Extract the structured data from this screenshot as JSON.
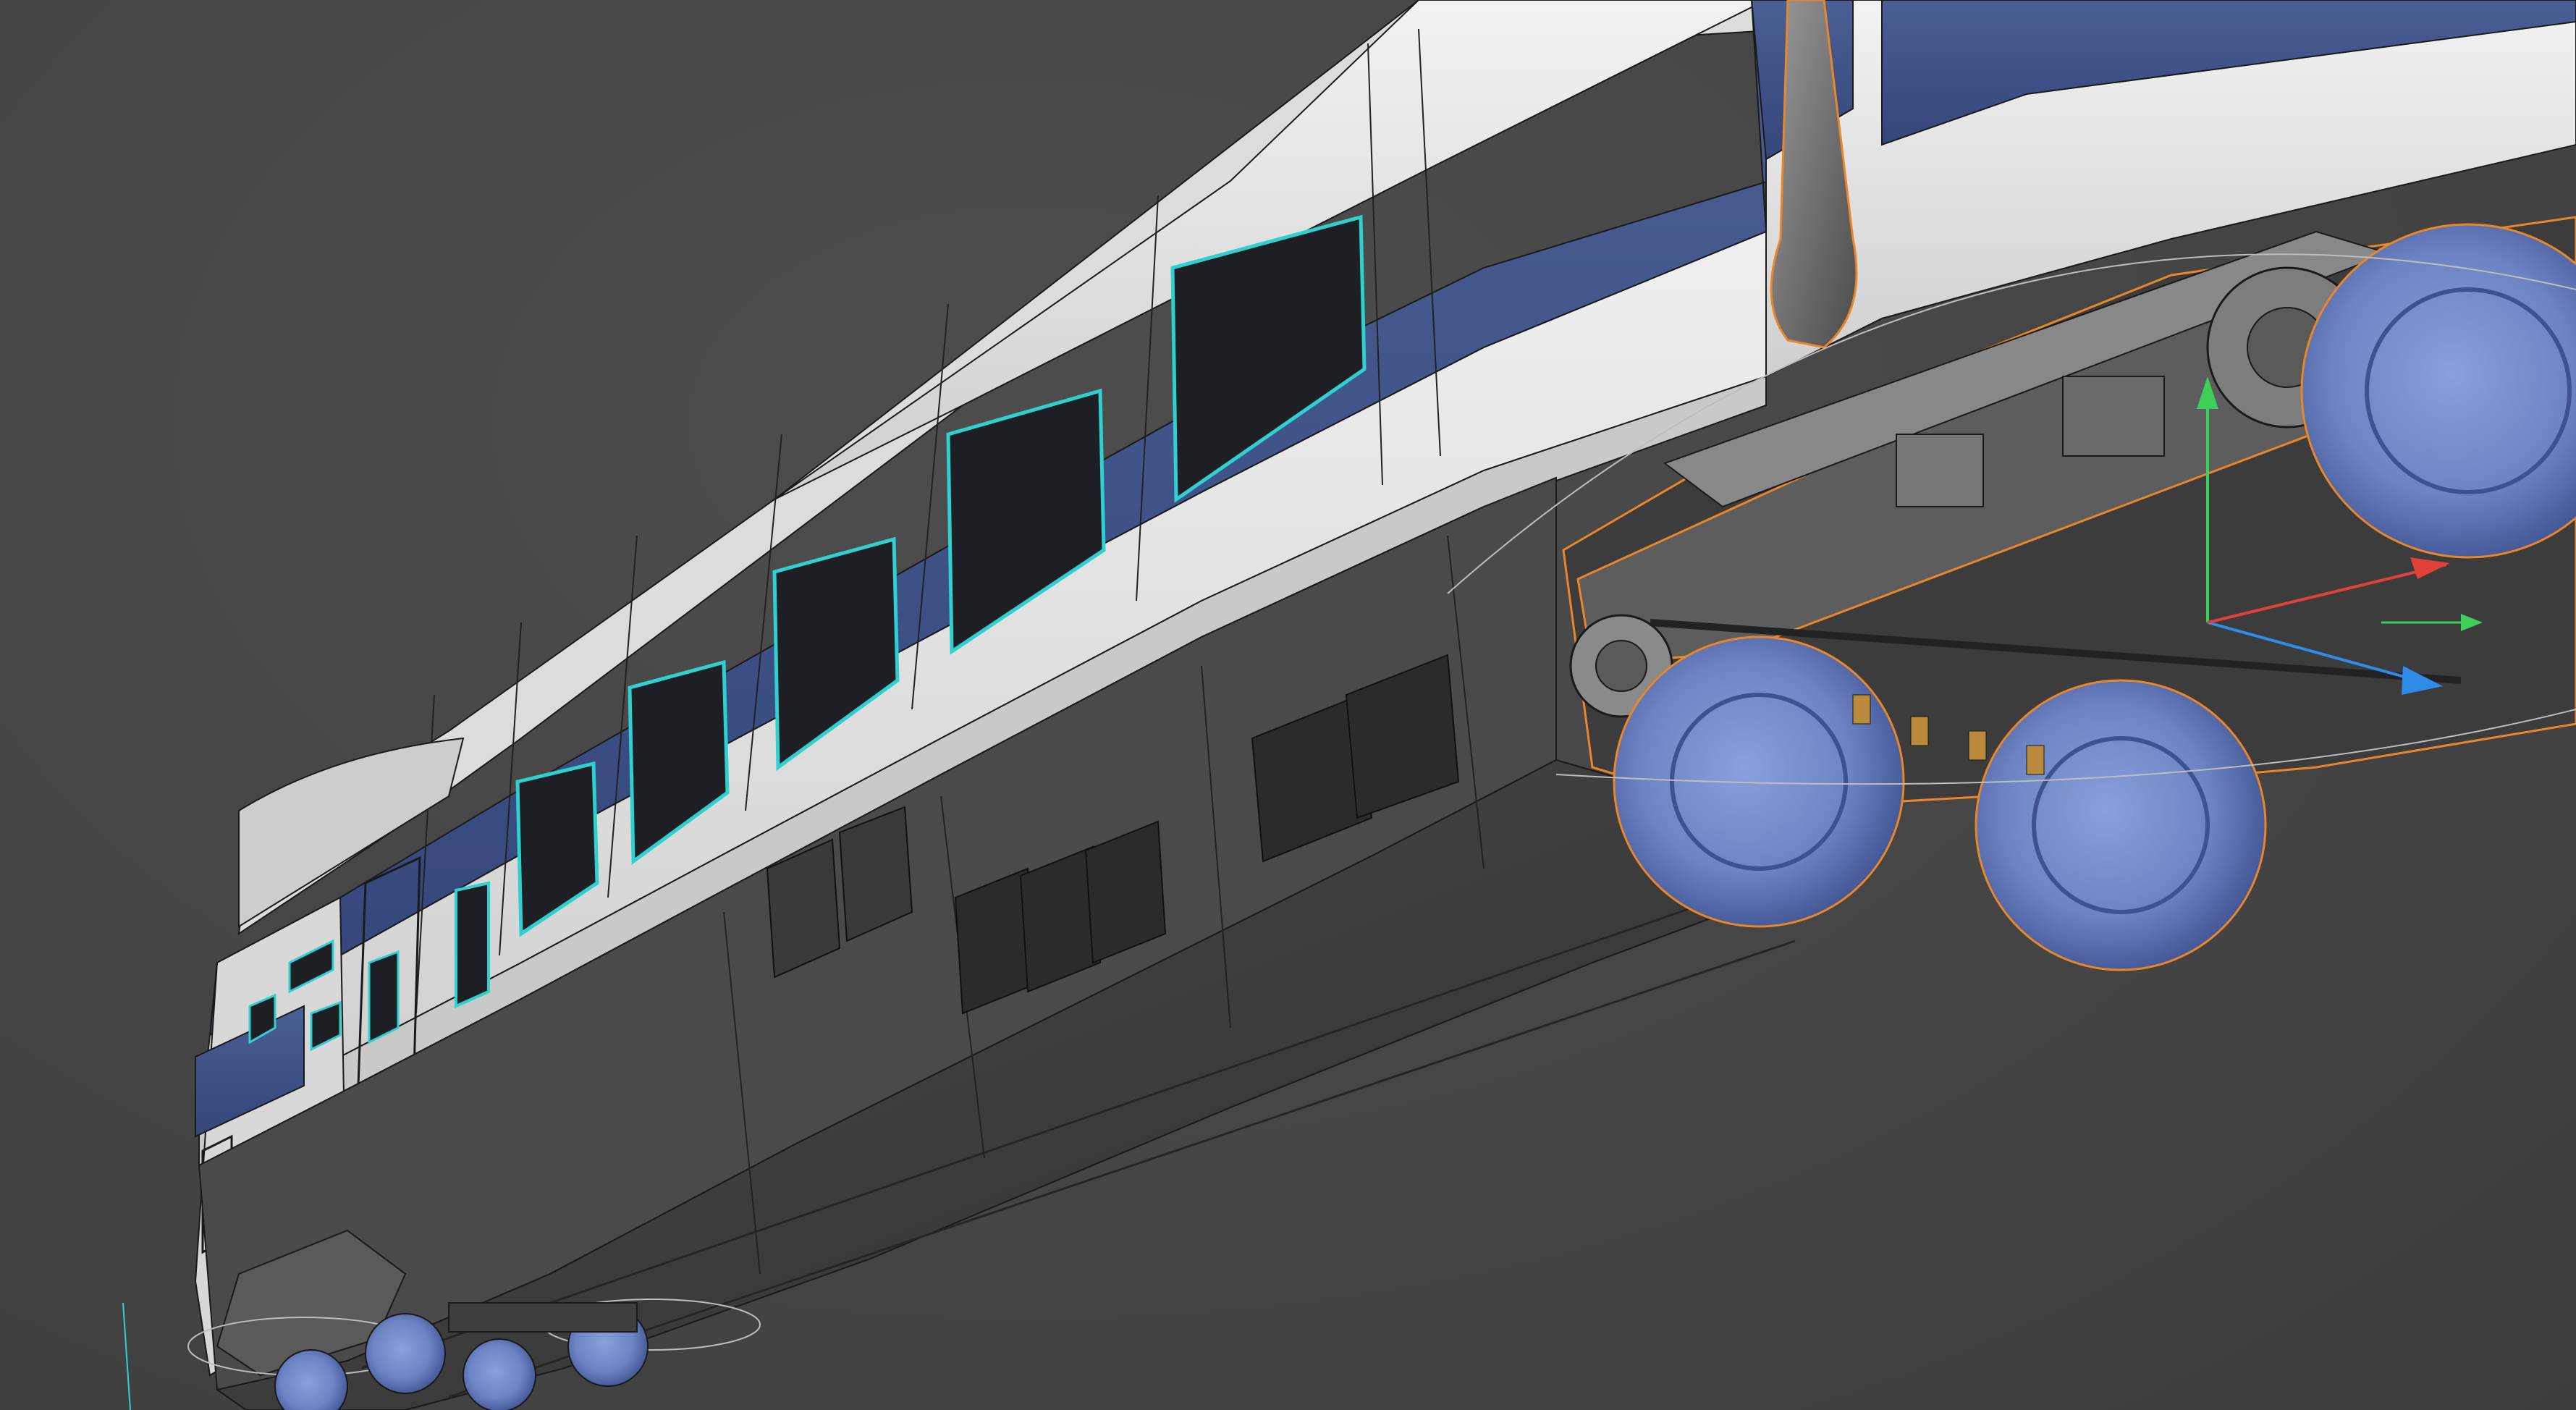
{
  "viewport": {
    "background_color": "#474747",
    "model": "passenger-railcar-with-bogies",
    "view": "low-angle-perspective",
    "selected_object": "rear-bogie",
    "selection_outline_color": "#e8862a"
  },
  "colors": {
    "body_white": "#e6e6e6",
    "livery_blue": "#3f5486",
    "window_glass": "#1d1f24",
    "window_edge": "#2fd0d0",
    "underframe": "#3a3a3a",
    "wheel_blue": "#6f86c6",
    "gizmo_x": "#e0403a",
    "gizmo_y": "#3ccf5a",
    "gizmo_z": "#2f8be8"
  },
  "gizmo": {
    "axes": [
      "x",
      "y",
      "z"
    ],
    "x_icon": "x-axis-arrow-icon",
    "y_icon": "y-axis-arrow-icon",
    "z_icon": "z-axis-arrow-icon"
  }
}
